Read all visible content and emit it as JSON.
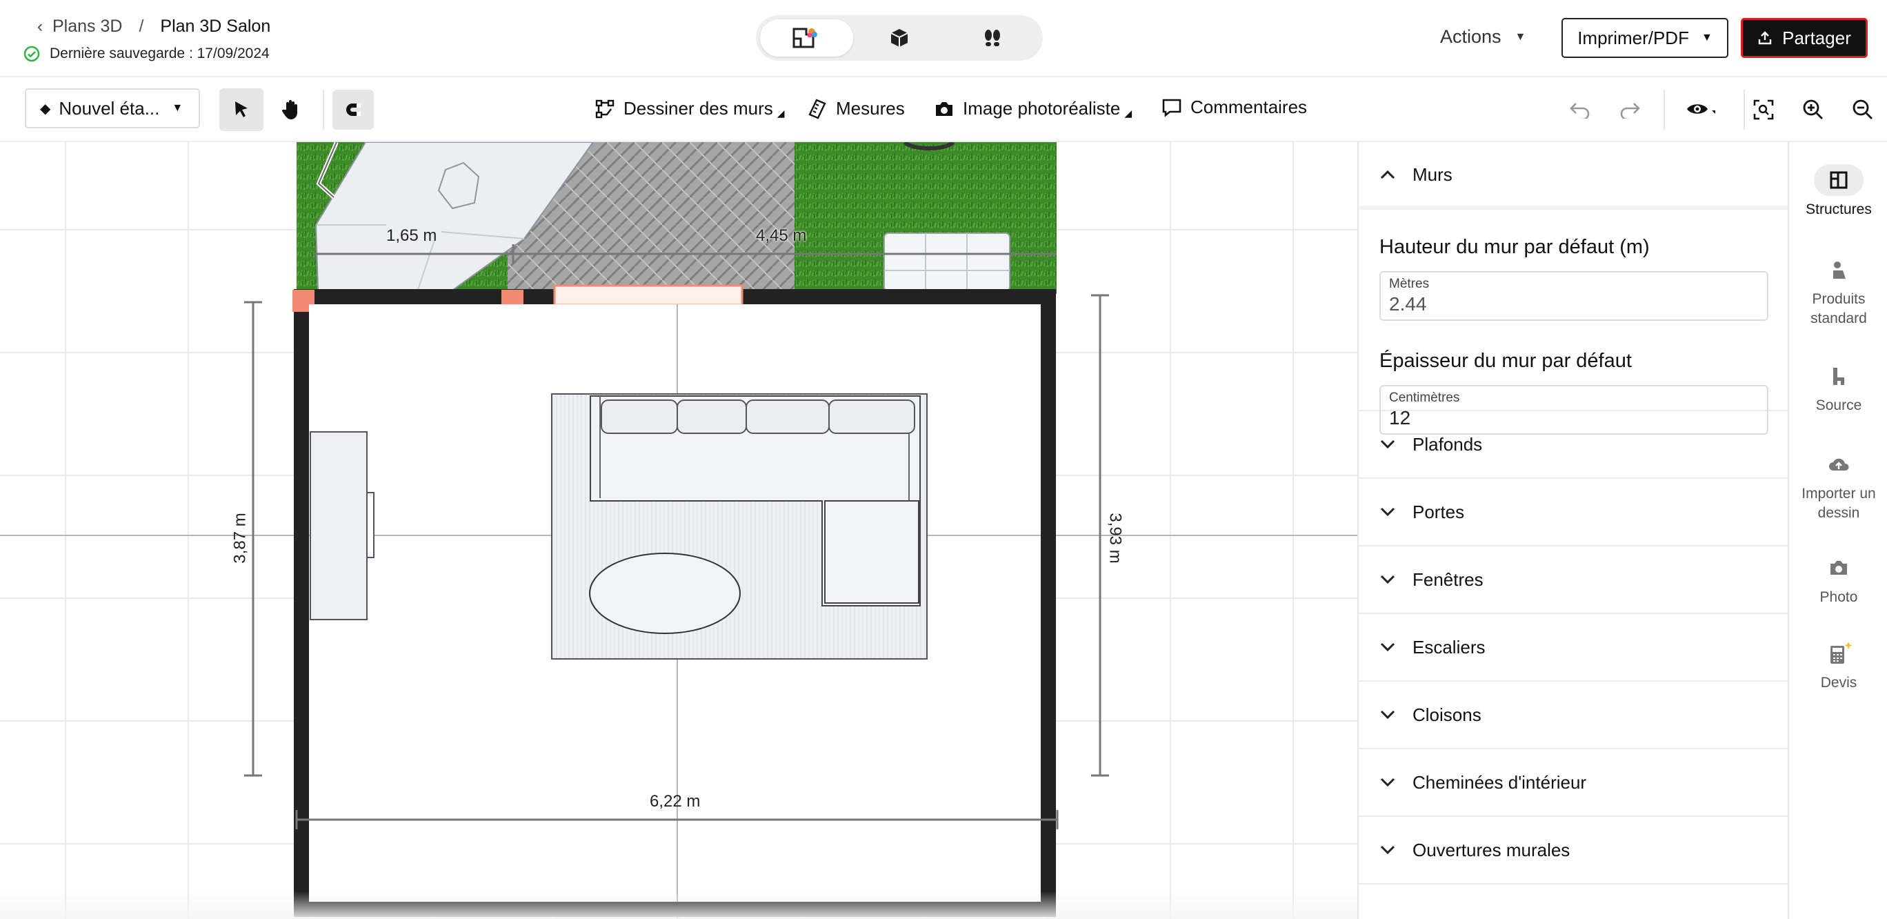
{
  "header": {
    "breadcrumb_parent": "Plans 3D",
    "breadcrumb_sep": "/",
    "breadcrumb_current": "Plan 3D Salon",
    "save_status": "Dernière sauvegarde : 17/09/2024",
    "view_modes": [
      "2d-plan-icon",
      "3d-box-icon",
      "walkthrough-footsteps-icon"
    ],
    "actions_label": "Actions",
    "print_label": "Imprimer/PDF",
    "share_label": "Partager"
  },
  "toolbar": {
    "floor_label": "Nouvel éta...",
    "draw_walls": "Dessiner des murs",
    "measures": "Mesures",
    "photo_render": "Image photoréaliste",
    "comments": "Commentaires"
  },
  "canvas": {
    "dim_top_left": "1,65 m",
    "dim_top_right": "4,45 m",
    "dim_left": "3,87 m",
    "dim_right": "3,93 m",
    "dim_bottom": "6,22 m"
  },
  "panel": {
    "walls_title": "Murs",
    "wall_height_title": "Hauteur du mur par défaut (m)",
    "wall_height_unit": "Mètres",
    "wall_height_value": "2.44",
    "wall_thickness_title": "Épaisseur du mur par défaut",
    "wall_thickness_unit": "Centimètres",
    "wall_thickness_value": "12",
    "sections": [
      "Plafonds",
      "Portes",
      "Fenêtres",
      "Escaliers",
      "Cloisons",
      "Cheminées d'intérieur",
      "Ouvertures murales"
    ]
  },
  "rail": {
    "structures": "Structures",
    "standard_products": "Produits standard",
    "source": "Source",
    "import_drawing": "Importer un dessin",
    "photo": "Photo",
    "quote": "Devis"
  },
  "colors": {
    "accent_red": "#e02020",
    "save_ok_green": "#2fb344",
    "wall": "#222222",
    "grass": "#3f8a2a",
    "handle": "#f28b74"
  }
}
